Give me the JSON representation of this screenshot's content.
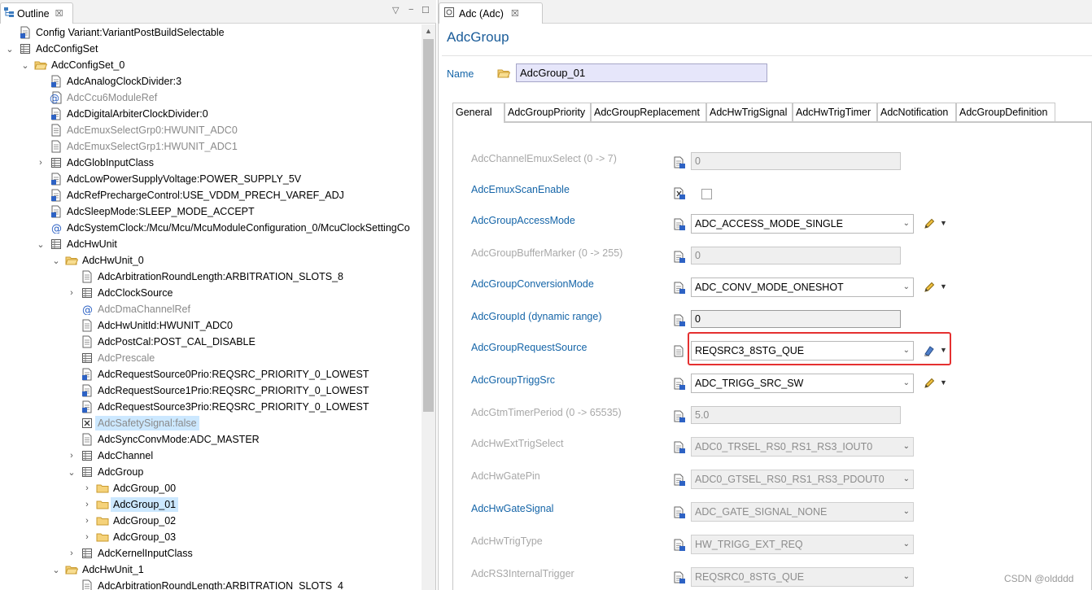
{
  "outline": {
    "tab_label": "Outline",
    "close_glyph": "☒",
    "menu_glyphs": [
      "▽",
      "−",
      "☐"
    ],
    "rows": [
      {
        "indent": 0,
        "twisty": "",
        "icon": "doc-blue-icon",
        "label": "Config Variant:VariantPostBuildSelectable",
        "disabled": false,
        "selected": false
      },
      {
        "indent": 0,
        "twisty": "⌄",
        "icon": "table-icon",
        "label": "AdcConfigSet",
        "disabled": false,
        "selected": false
      },
      {
        "indent": 1,
        "twisty": "⌄",
        "icon": "folder-open-icon",
        "label": "AdcConfigSet_0",
        "disabled": false,
        "selected": false
      },
      {
        "indent": 2,
        "twisty": "",
        "icon": "doc-blue-icon",
        "label": "AdcAnalogClockDivider:3",
        "disabled": false,
        "selected": false
      },
      {
        "indent": 2,
        "twisty": "",
        "icon": "at-doc-icon",
        "label": "AdcCcu6ModuleRef",
        "disabled": true,
        "selected": false
      },
      {
        "indent": 2,
        "twisty": "",
        "icon": "doc-blue-icon",
        "label": "AdcDigitalArbiterClockDivider:0",
        "disabled": false,
        "selected": false
      },
      {
        "indent": 2,
        "twisty": "",
        "icon": "doc-gray-icon",
        "label": "AdcEmuxSelectGrp0:HWUNIT_ADC0",
        "disabled": true,
        "selected": false
      },
      {
        "indent": 2,
        "twisty": "",
        "icon": "doc-gray-icon",
        "label": "AdcEmuxSelectGrp1:HWUNIT_ADC1",
        "disabled": true,
        "selected": false
      },
      {
        "indent": 2,
        "twisty": "›",
        "icon": "table-icon",
        "label": "AdcGlobInputClass",
        "disabled": false,
        "selected": false
      },
      {
        "indent": 2,
        "twisty": "",
        "icon": "doc-blue-icon",
        "label": "AdcLowPowerSupplyVoltage:POWER_SUPPLY_5V",
        "disabled": false,
        "selected": false
      },
      {
        "indent": 2,
        "twisty": "",
        "icon": "doc-blue-icon",
        "label": "AdcRefPrechargeControl:USE_VDDM_PRECH_VAREF_ADJ",
        "disabled": false,
        "selected": false
      },
      {
        "indent": 2,
        "twisty": "",
        "icon": "doc-blue-icon",
        "label": "AdcSleepMode:SLEEP_MODE_ACCEPT",
        "disabled": false,
        "selected": false
      },
      {
        "indent": 2,
        "twisty": "",
        "icon": "at-icon",
        "label": "AdcSystemClock:/Mcu/Mcu/McuModuleConfiguration_0/McuClockSettingCo",
        "disabled": false,
        "selected": false
      },
      {
        "indent": 2,
        "twisty": "⌄",
        "icon": "table-icon",
        "label": "AdcHwUnit",
        "disabled": false,
        "selected": false
      },
      {
        "indent": 3,
        "twisty": "⌄",
        "icon": "folder-open-icon",
        "label": "AdcHwUnit_0",
        "disabled": false,
        "selected": false
      },
      {
        "indent": 4,
        "twisty": "",
        "icon": "doc-gray-icon",
        "label": "AdcArbitrationRoundLength:ARBITRATION_SLOTS_8",
        "disabled": false,
        "selected": false
      },
      {
        "indent": 4,
        "twisty": "›",
        "icon": "table-icon",
        "label": "AdcClockSource",
        "disabled": false,
        "selected": false
      },
      {
        "indent": 4,
        "twisty": "",
        "icon": "at-icon",
        "label": "AdcDmaChannelRef",
        "disabled": true,
        "selected": false
      },
      {
        "indent": 4,
        "twisty": "",
        "icon": "doc-gray-icon",
        "label": "AdcHwUnitId:HWUNIT_ADC0",
        "disabled": false,
        "selected": false
      },
      {
        "indent": 4,
        "twisty": "",
        "icon": "doc-gray-icon",
        "label": "AdcPostCal:POST_CAL_DISABLE",
        "disabled": false,
        "selected": false
      },
      {
        "indent": 4,
        "twisty": "",
        "icon": "table-icon",
        "label": "AdcPrescale",
        "disabled": true,
        "selected": false
      },
      {
        "indent": 4,
        "twisty": "",
        "icon": "doc-blue-icon",
        "label": "AdcRequestSource0Prio:REQSRC_PRIORITY_0_LOWEST",
        "disabled": false,
        "selected": false
      },
      {
        "indent": 4,
        "twisty": "",
        "icon": "doc-blue-icon",
        "label": "AdcRequestSource1Prio:REQSRC_PRIORITY_0_LOWEST",
        "disabled": false,
        "selected": false
      },
      {
        "indent": 4,
        "twisty": "",
        "icon": "doc-blue-icon",
        "label": "AdcRequestSource3Prio:REQSRC_PRIORITY_0_LOWEST",
        "disabled": false,
        "selected": false
      },
      {
        "indent": 4,
        "twisty": "",
        "icon": "checkbox-x-icon",
        "label": "AdcSafetySignal:false",
        "disabled": true,
        "selected": true
      },
      {
        "indent": 4,
        "twisty": "",
        "icon": "doc-gray-icon",
        "label": "AdcSyncConvMode:ADC_MASTER",
        "disabled": false,
        "selected": false
      },
      {
        "indent": 4,
        "twisty": "›",
        "icon": "table-icon",
        "label": "AdcChannel",
        "disabled": false,
        "selected": false
      },
      {
        "indent": 4,
        "twisty": "⌄",
        "icon": "table-icon",
        "label": "AdcGroup",
        "disabled": false,
        "selected": false
      },
      {
        "indent": 5,
        "twisty": "›",
        "icon": "folder-icon",
        "label": "AdcGroup_00",
        "disabled": false,
        "selected": false
      },
      {
        "indent": 5,
        "twisty": "›",
        "icon": "folder-icon",
        "label": "AdcGroup_01",
        "disabled": false,
        "selected": true
      },
      {
        "indent": 5,
        "twisty": "›",
        "icon": "folder-icon",
        "label": "AdcGroup_02",
        "disabled": false,
        "selected": false
      },
      {
        "indent": 5,
        "twisty": "›",
        "icon": "folder-icon",
        "label": "AdcGroup_03",
        "disabled": false,
        "selected": false
      },
      {
        "indent": 4,
        "twisty": "›",
        "icon": "table-icon",
        "label": "AdcKernelInputClass",
        "disabled": false,
        "selected": false
      },
      {
        "indent": 3,
        "twisty": "⌄",
        "icon": "folder-open-icon",
        "label": "AdcHwUnit_1",
        "disabled": false,
        "selected": false
      },
      {
        "indent": 4,
        "twisty": "",
        "icon": "doc-gray-icon",
        "label": "AdcArbitrationRoundLength:ARBITRATION_SLOTS_4",
        "disabled": false,
        "selected": false
      }
    ]
  },
  "editor": {
    "tab_label": "Adc (Adc)",
    "close_glyph": "☒",
    "title": "AdcGroup",
    "name_label": "Name",
    "name_value": "AdcGroup_01",
    "section_tabs": [
      "General",
      "AdcGroupPriority",
      "AdcGroupReplacement",
      "AdcHwTrigSignal",
      "AdcHwTrigTimer",
      "AdcNotification",
      "AdcGroupDefinition"
    ],
    "params": [
      {
        "label": "AdcChannelEmuxSelect (0 -> 7)",
        "enabled": false,
        "control": "text",
        "value": "0",
        "edit": false
      },
      {
        "label": "AdcEmuxScanEnable",
        "enabled": true,
        "control": "checkbox",
        "value": "",
        "edit": false
      },
      {
        "label": "AdcGroupAccessMode",
        "enabled": true,
        "control": "combo",
        "value": "ADC_ACCESS_MODE_SINGLE",
        "edit": true
      },
      {
        "label": "AdcGroupBufferMarker (0 -> 255)",
        "enabled": false,
        "control": "text",
        "value": "0",
        "edit": false
      },
      {
        "label": "AdcGroupConversionMode",
        "enabled": true,
        "control": "combo",
        "value": "ADC_CONV_MODE_ONESHOT",
        "edit": true
      },
      {
        "label": "AdcGroupId (dynamic range)",
        "enabled": true,
        "control": "text",
        "value": "0",
        "edit": false
      },
      {
        "label": "AdcGroupRequestSource",
        "enabled": true,
        "control": "combo",
        "value": "REQSRC3_8STG_QUE",
        "edit": true
      },
      {
        "label": "AdcGroupTriggSrc",
        "enabled": true,
        "control": "combo",
        "value": "ADC_TRIGG_SRC_SW",
        "edit": true
      },
      {
        "label": "AdcGtmTimerPeriod (0 -> 65535)",
        "enabled": false,
        "control": "text",
        "value": "5.0",
        "edit": false
      },
      {
        "label": "AdcHwExtTrigSelect",
        "enabled": false,
        "control": "combo",
        "value": "ADC0_TRSEL_RS0_RS1_RS3_IOUT0",
        "edit": false
      },
      {
        "label": "AdcHwGatePin",
        "enabled": false,
        "control": "combo",
        "value": "ADC0_GTSEL_RS0_RS1_RS3_PDOUT0",
        "edit": false
      },
      {
        "label": "AdcHwGateSignal",
        "enabled": true,
        "control": "combo-disabled",
        "value": "ADC_GATE_SIGNAL_NONE",
        "edit": false
      },
      {
        "label": "AdcHwTrigType",
        "enabled": false,
        "control": "combo",
        "value": "HW_TRIGG_EXT_REQ",
        "edit": false
      },
      {
        "label": "AdcRS3InternalTrigger",
        "enabled": false,
        "control": "combo",
        "value": "REQSRC0_8STG_QUE",
        "edit": false
      }
    ]
  },
  "watermark": "CSDN @oldddd"
}
